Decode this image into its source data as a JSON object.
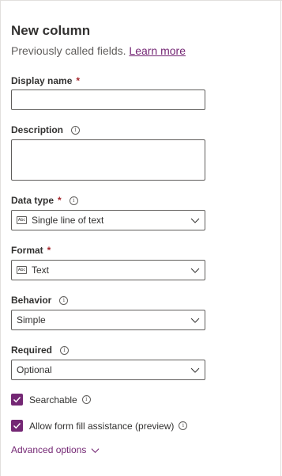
{
  "panel": {
    "title": "New column",
    "subtitle": "Previously called fields.",
    "learn_more": "Learn more"
  },
  "fields": {
    "display_name": {
      "label": "Display name",
      "required": "*",
      "value": ""
    },
    "description": {
      "label": "Description",
      "value": ""
    },
    "data_type": {
      "label": "Data type",
      "required": "*",
      "value": "Single line of text",
      "icon": "Abc"
    },
    "format": {
      "label": "Format",
      "required": "*",
      "value": "Text",
      "icon": "Abc"
    },
    "behavior": {
      "label": "Behavior",
      "value": "Simple"
    },
    "required": {
      "label": "Required",
      "value": "Optional"
    }
  },
  "checkboxes": {
    "searchable": {
      "label": "Searchable",
      "checked": true
    },
    "form_fill": {
      "label": "Allow form fill assistance (preview)",
      "checked": true
    }
  },
  "advanced": {
    "label": "Advanced options"
  },
  "info_glyph": "i",
  "colors": {
    "accent": "#742774",
    "required": "#a4262c",
    "border": "#605e5c"
  }
}
